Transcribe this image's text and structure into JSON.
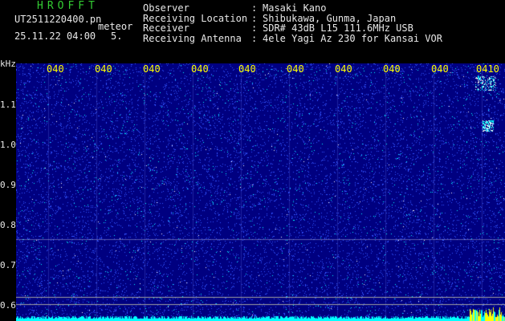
{
  "header": {
    "brand": "HROFFT",
    "file_name": "UT2511220400.pn",
    "tag": "meteor",
    "datetime": "25.11.22 04:00",
    "count": "5.",
    "info": [
      {
        "key": "Observer",
        "value": "Masaki Kano"
      },
      {
        "key": "Receiving Location",
        "value": "Shibukawa, Gunma, Japan"
      },
      {
        "key": "Receiver",
        "value": "SDR# 43dB L15 111.6MHz USB"
      },
      {
        "key": "Receiving Antenna",
        "value": "4ele Yagi Az 230 for Kansai VOR"
      }
    ]
  },
  "chart_data": {
    "type": "heatmap",
    "ylabel": "kHz",
    "y_ticks": [
      "1.1",
      "1.0",
      "0.9",
      "0.8",
      "0.7",
      "0.6"
    ],
    "x_ticks": [
      "040",
      "040",
      "040",
      "040",
      "040",
      "040",
      "040",
      "040",
      "040",
      "040",
      "0410"
    ],
    "colors": {
      "background": "#000080",
      "noise": "#3355ff",
      "signal": "#00ffff",
      "peak": "#ffff00",
      "label": "#ffff00",
      "grid": "#a0a0a0"
    }
  }
}
